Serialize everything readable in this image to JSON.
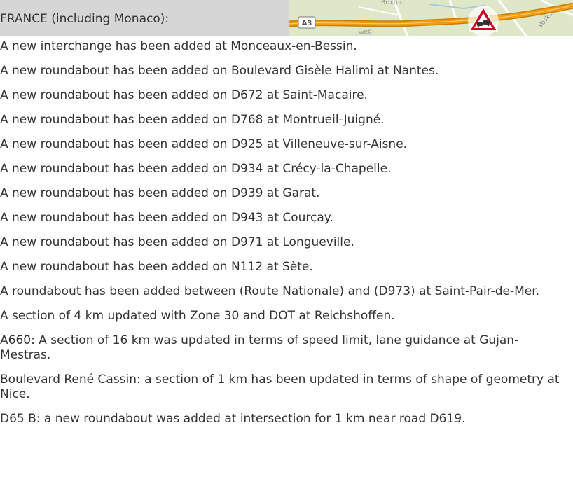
{
  "header": {
    "title": "FRANCE (including Monaco):",
    "map": {
      "road_shield": "A3",
      "street_label_top": "Brixton...",
      "street_label_bottom": "...weg",
      "street_label_right": "Vosk...",
      "icon": "traffic-warning-icon"
    }
  },
  "items": [
    "A new interchange has been added at Monceaux-en-Bessin.",
    "A new roundabout has been added on Boulevard Gisèle Halimi at Nantes.",
    "A new roundabout has been added on D672 at Saint-Macaire.",
    "A new roundabout has been added on D768 at Montrueil-Juigné.",
    "A new roundabout has been added on D925 at Villeneuve-sur-Aisne.",
    "A new roundabout has been added on D934 at Crécy-la-Chapelle.",
    "A new roundabout has been added on D939 at Garat.",
    "A new roundabout has been added on D943 at Courçay.",
    "A new roundabout has been added on D971 at Longueville.",
    "A new roundabout has been added on N112 at Sète.",
    "A roundabout has been added between (Route Nationale) and (D973) at Saint-Pair-de-Mer.",
    "A section of 4 km updated with Zone 30 and DOT at Reichshoffen.",
    "A660: A section of 16 km was updated in terms of speed limit, lane guidance at Gujan-Mestras.",
    "Boulevard René Cassin: a section of 1 km has been updated in terms of shape of geometry at Nice.",
    "D65 B: a new roundabout was added at intersection for 1 km near road D619."
  ],
  "colors": {
    "header_bg": "#d6d6d6",
    "text": "#333333",
    "map_bg": "#dfe7c9",
    "road_orange": "#f39c12",
    "warning_red": "#d0021b"
  }
}
